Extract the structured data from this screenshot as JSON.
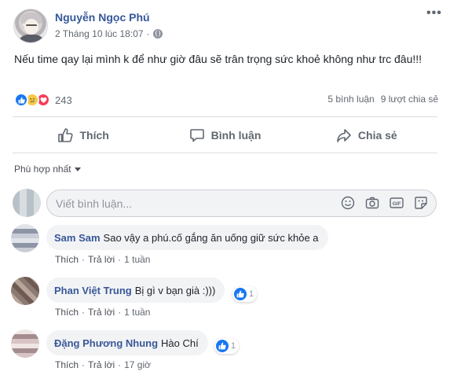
{
  "post": {
    "author": "Nguyễn Ngọc Phú",
    "time": "2 Tháng 10 lúc 18:07",
    "separator": "·",
    "text": "Nếu time qay lại mình k để như giờ đâu sẽ trân trọng sức khoẻ không như trc đâu!!!",
    "reaction_count": "243",
    "comments_count": "5 bình luận",
    "shares_count": "9 lượt chia sẻ",
    "more_label": "•••"
  },
  "actions": {
    "like": "Thích",
    "comment": "Bình luận",
    "share": "Chia sẻ"
  },
  "sort_label": "Phù hợp nhất",
  "composer": {
    "placeholder": "Viết bình luận..."
  },
  "comments": [
    {
      "name": "Sam Sam",
      "text": "Sao vậy a phú.cố gắng ăn uống giữ sức khỏe a",
      "like_label": "Thích",
      "reply_label": "Trả lời",
      "dot": "·",
      "time": "1 tuần",
      "likes": ""
    },
    {
      "name": "Phan Việt Trung",
      "text": "Bị gì v bạn già :)))",
      "like_label": "Thích",
      "reply_label": "Trả lời",
      "dot": "·",
      "time": "1 tuần",
      "likes": "1"
    },
    {
      "name": "Đặng Phương Nhung",
      "text": "Hào Chí",
      "like_label": "Thích",
      "reply_label": "Trả lời",
      "dot": "·",
      "time": "17 giờ",
      "likes": "1"
    }
  ],
  "colors": {
    "link_blue": "#365899",
    "like_blue": "#1877f2",
    "love_red": "#f33e58",
    "sad_yellow": "#f7c94a",
    "muted_text": "#606770"
  }
}
